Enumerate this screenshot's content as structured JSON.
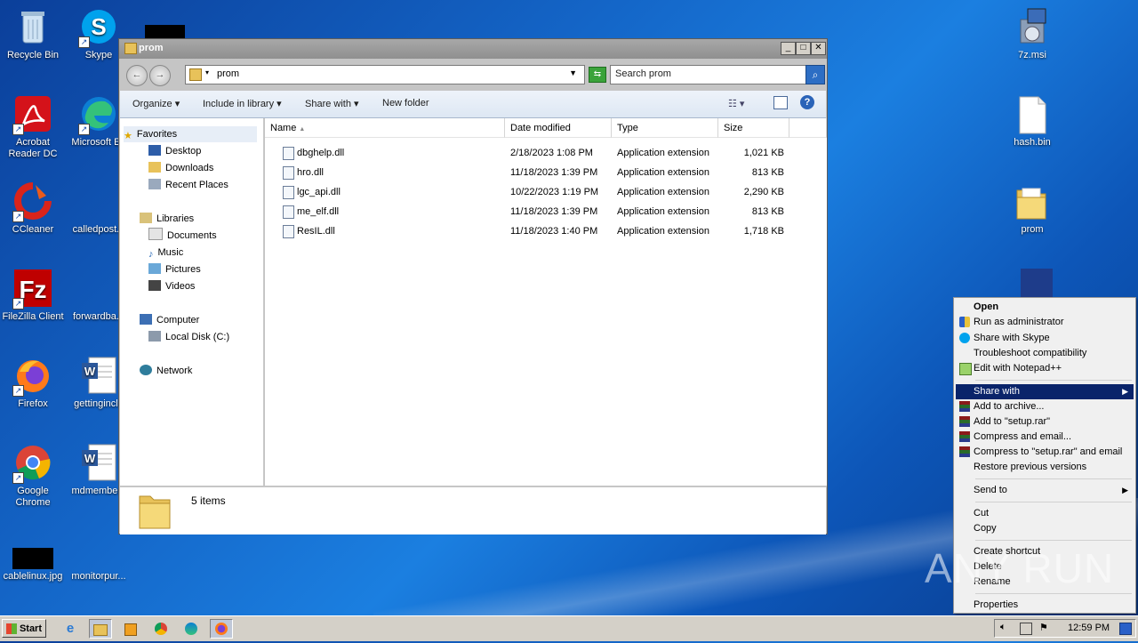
{
  "desktop": {
    "icons": {
      "recycle_bin": "Recycle Bin",
      "skype": "Skype",
      "acrobat": "Acrobat Reader DC",
      "edge": "Microsoft Ed",
      "ccleaner": "CCleaner",
      "calledpost": "calledpost.p",
      "filezilla": "FileZilla Client",
      "forwardba": "forwardba...",
      "firefox": "Firefox",
      "gettinginclu": "gettinginclu",
      "chrome": "Google Chrome",
      "mdmembers": "mdmembers",
      "cablelinux": "cablelinux.jpg",
      "monitorpur": "monitorpur...",
      "zip_msi": "7z.msi",
      "hash_bin": "hash.bin",
      "prom_folder": "prom"
    }
  },
  "window": {
    "title": "prom",
    "address": "prom",
    "search_placeholder": "Search prom",
    "toolbar": {
      "organize": "Organize",
      "include_in_library": "Include in library",
      "share_with": "Share with",
      "new_folder": "New folder"
    },
    "nav": {
      "favorites": "Favorites",
      "desktop": "Desktop",
      "downloads": "Downloads",
      "recent_places": "Recent Places",
      "libraries": "Libraries",
      "documents": "Documents",
      "music": "Music",
      "pictures": "Pictures",
      "videos": "Videos",
      "computer": "Computer",
      "local_disk": "Local Disk (C:)",
      "network": "Network"
    },
    "columns": {
      "name": "Name",
      "date": "Date modified",
      "type": "Type",
      "size": "Size"
    },
    "files": [
      {
        "name": "dbghelp.dll",
        "date": "2/18/2023 1:08 PM",
        "type": "Application extension",
        "size": "1,021 KB"
      },
      {
        "name": "hro.dll",
        "date": "11/18/2023 1:39 PM",
        "type": "Application extension",
        "size": "813 KB"
      },
      {
        "name": "lgc_api.dll",
        "date": "10/22/2023 1:19 PM",
        "type": "Application extension",
        "size": "2,290 KB"
      },
      {
        "name": "me_elf.dll",
        "date": "11/18/2023 1:39 PM",
        "type": "Application extension",
        "size": "813 KB"
      },
      {
        "name": "ResIL.dll",
        "date": "11/18/2023 1:40 PM",
        "type": "Application extension",
        "size": "1,718 KB"
      }
    ],
    "status": "5 items"
  },
  "context_menu": {
    "open": "Open",
    "run_as_admin": "Run as administrator",
    "share_with_skype": "Share with Skype",
    "troubleshoot": "Troubleshoot compatibility",
    "edit_notepad": "Edit with Notepad++",
    "share_with": "Share with",
    "add_to_archive": "Add to archive...",
    "add_to_setup_rar": "Add to \"setup.rar\"",
    "compress_email": "Compress and email...",
    "compress_setup_email": "Compress to \"setup.rar\" and email",
    "restore_versions": "Restore previous versions",
    "send_to": "Send to",
    "cut": "Cut",
    "copy": "Copy",
    "create_shortcut": "Create shortcut",
    "delete": "Delete",
    "rename": "Rename",
    "properties": "Properties"
  },
  "taskbar": {
    "start": "Start",
    "clock": "12:59 PM"
  },
  "watermark": "ANY RUN"
}
